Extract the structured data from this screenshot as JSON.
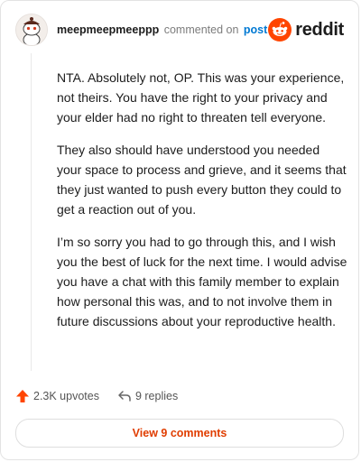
{
  "comment": {
    "author": "meepmeepmeeppp",
    "action_text": "commented on",
    "target_link": "post",
    "paragraphs": [
      "NTA. Absolutely not, OP. This was your experience, not theirs. You have the right to your privacy and your elder had no right to threaten tell everyone.",
      "They also should have understood you needed your space to process and grieve, and it seems that they just wanted to push every button they could to get a reaction out of you.",
      "I’m so sorry you had to go through this, and I wish you the best of luck for the next time. I would advise you have a chat with this family member to explain how personal this was, and to not involve them in future discussions about your reproductive health."
    ]
  },
  "logo": {
    "text": "reddit",
    "icon": "reddit-snoo-icon"
  },
  "actions": {
    "upvotes": "2.3K upvotes",
    "replies": "9 replies",
    "upvote_icon": "upvote-arrow-icon",
    "reply_icon": "reply-arrow-icon"
  },
  "view_button": {
    "label": "View 9 comments"
  },
  "colors": {
    "reddit_orange": "#ff4500",
    "link_blue": "#0079d3",
    "button_text": "#e03d00"
  }
}
